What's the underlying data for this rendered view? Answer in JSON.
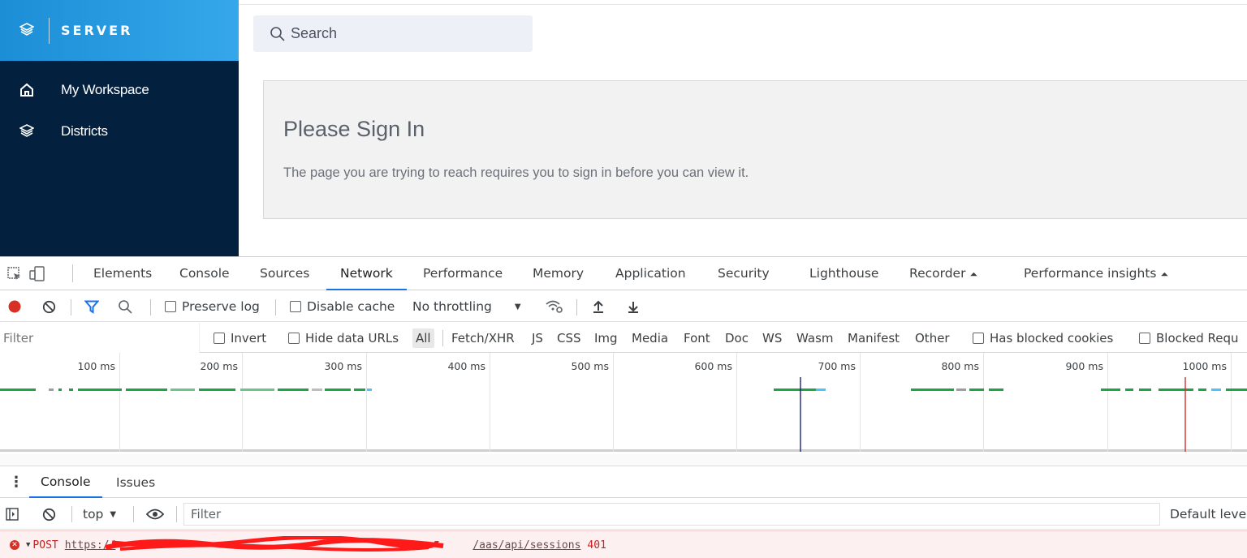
{
  "app": {
    "brand": "SERVER",
    "nav": [
      {
        "label": "My Workspace",
        "icon": "home-icon"
      },
      {
        "label": "Districts",
        "icon": "layers-icon"
      }
    ],
    "search_placeholder": "Search",
    "signin": {
      "title": "Please Sign In",
      "message": "The page you are trying to reach requires you to sign in before you can view it."
    }
  },
  "devtools": {
    "tabs": [
      "Elements",
      "Console",
      "Sources",
      "Network",
      "Performance",
      "Memory",
      "Application",
      "Security",
      "Lighthouse",
      "Recorder",
      "Performance insights"
    ],
    "active_tab": "Network",
    "network_toolbar": {
      "preserve_log": "Preserve log",
      "disable_cache": "Disable cache",
      "throttling": "No throttling"
    },
    "filter_row": {
      "placeholder": "Filter",
      "invert": "Invert",
      "hide_data_urls": "Hide data URLs",
      "types": [
        "All",
        "Fetch/XHR",
        "JS",
        "CSS",
        "Img",
        "Media",
        "Font",
        "Doc",
        "WS",
        "Wasm",
        "Manifest",
        "Other"
      ],
      "has_blocked_cookies": "Has blocked cookies",
      "blocked_requests": "Blocked Requ"
    },
    "timeline": {
      "ticks": [
        "100 ms",
        "200 ms",
        "300 ms",
        "400 ms",
        "500 ms",
        "600 ms",
        "700 ms",
        "800 ms",
        "900 ms",
        "1000 ms"
      ],
      "dom_content_loaded_color": "#1a237e",
      "load_color": "#d32f2f",
      "bar_color": "#1ea446"
    },
    "drawer": {
      "tabs": [
        "Console",
        "Issues"
      ],
      "active": "Console",
      "context": "top",
      "filter_placeholder": "Filter",
      "levels": "Default leve"
    },
    "console_error": {
      "method": "POST",
      "url": "https://",
      "url_tail": "/aas/api/sessions",
      "status": "401"
    }
  }
}
